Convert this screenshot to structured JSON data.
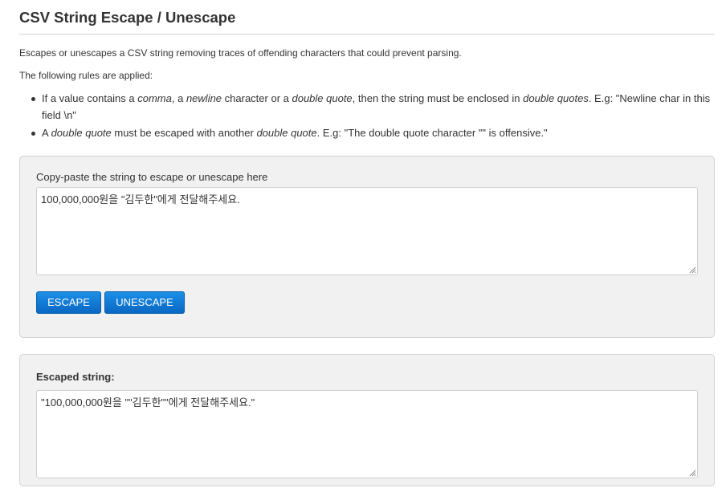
{
  "page": {
    "title": "CSV String Escape / Unescape",
    "description": "Escapes or unescapes a CSV string removing traces of offending characters that could prevent parsing.",
    "rules_intro": "The following rules are applied:"
  },
  "rules": [
    {
      "parts": [
        "If a value contains a ",
        "comma",
        ", a ",
        "newline",
        " character or a ",
        "double quote",
        ", then the string must be enclosed in ",
        "double quotes",
        ". E.g: \"Newline char in this field \\n\""
      ]
    },
    {
      "parts": [
        "A ",
        "double quote",
        " must be escaped with another ",
        "double quote",
        ". E.g: \"The double quote character \"\" is offensive.\""
      ]
    }
  ],
  "input_panel": {
    "label": "Copy-paste the string to escape or unescape here",
    "value": "100,000,000원을 \"김두한\"에게 전달해주세요.",
    "escape_button": "ESCAPE",
    "unescape_button": "UNESCAPE"
  },
  "output_panel": {
    "label": "Escaped string:",
    "value": "\"100,000,000원을 \"\"김두한\"\"에게 전달해주세요.\""
  },
  "colors": {
    "button_blue": "#0a68c4",
    "panel_bg": "#f1f1f1"
  },
  "icons": {
    "resize_grip": "resize-grip-icon",
    "bullet": "bullet-icon"
  }
}
